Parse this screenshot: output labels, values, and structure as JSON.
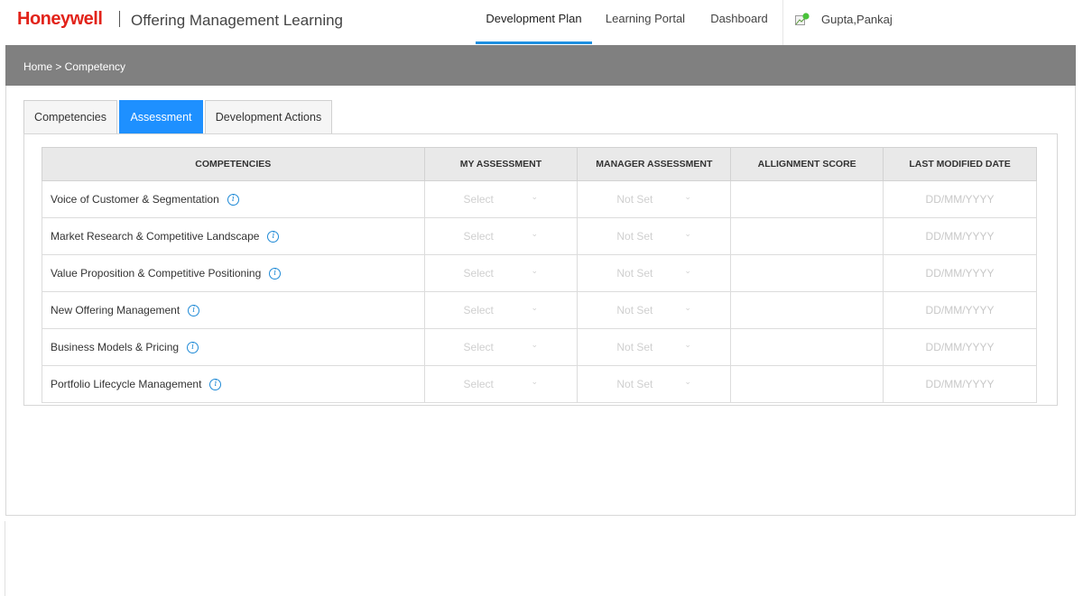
{
  "header": {
    "brand": "Honeywell",
    "app_title": "Offering Management Learning",
    "nav": [
      {
        "label": "Development Plan",
        "active": true
      },
      {
        "label": "Learning Portal",
        "active": false
      },
      {
        "label": "Dashboard",
        "active": false
      }
    ],
    "user_name": "Gupta,Pankaj"
  },
  "breadcrumb": "Home > Competency",
  "tabs": [
    {
      "label": "Competencies",
      "active": false
    },
    {
      "label": "Assessment",
      "active": true
    },
    {
      "label": "Development Actions",
      "active": false
    }
  ],
  "table": {
    "headers": [
      "COMPETENCIES",
      "MY ASSESSMENT",
      "MANAGER ASSESSMENT",
      "ALLIGNMENT SCORE",
      "LAST MODIFIED DATE"
    ],
    "rows": [
      {
        "competency": "Voice of Customer & Segmentation",
        "my_assessment": "Select",
        "manager_assessment": "Not Set",
        "alignment_score": "",
        "last_modified": "DD/MM/YYYY"
      },
      {
        "competency": "Market Research & Competitive Landscape",
        "my_assessment": "Select",
        "manager_assessment": "Not Set",
        "alignment_score": "",
        "last_modified": "DD/MM/YYYY"
      },
      {
        "competency": "Value Proposition & Competitive Positioning",
        "my_assessment": "Select",
        "manager_assessment": "Not Set",
        "alignment_score": "",
        "last_modified": "DD/MM/YYYY"
      },
      {
        "competency": "New Offering Management",
        "my_assessment": "Select",
        "manager_assessment": "Not Set",
        "alignment_score": "",
        "last_modified": "DD/MM/YYYY"
      },
      {
        "competency": "Business Models & Pricing",
        "my_assessment": "Select",
        "manager_assessment": "Not Set",
        "alignment_score": "",
        "last_modified": "DD/MM/YYYY"
      },
      {
        "competency": "Portfolio Lifecycle Management",
        "my_assessment": "Select",
        "manager_assessment": "Not Set",
        "alignment_score": "",
        "last_modified": "DD/MM/YYYY"
      }
    ]
  },
  "colors": {
    "brand_red": "#e2231a",
    "accent_blue": "#1e90ff",
    "breadcrumb_bg": "#808080"
  }
}
